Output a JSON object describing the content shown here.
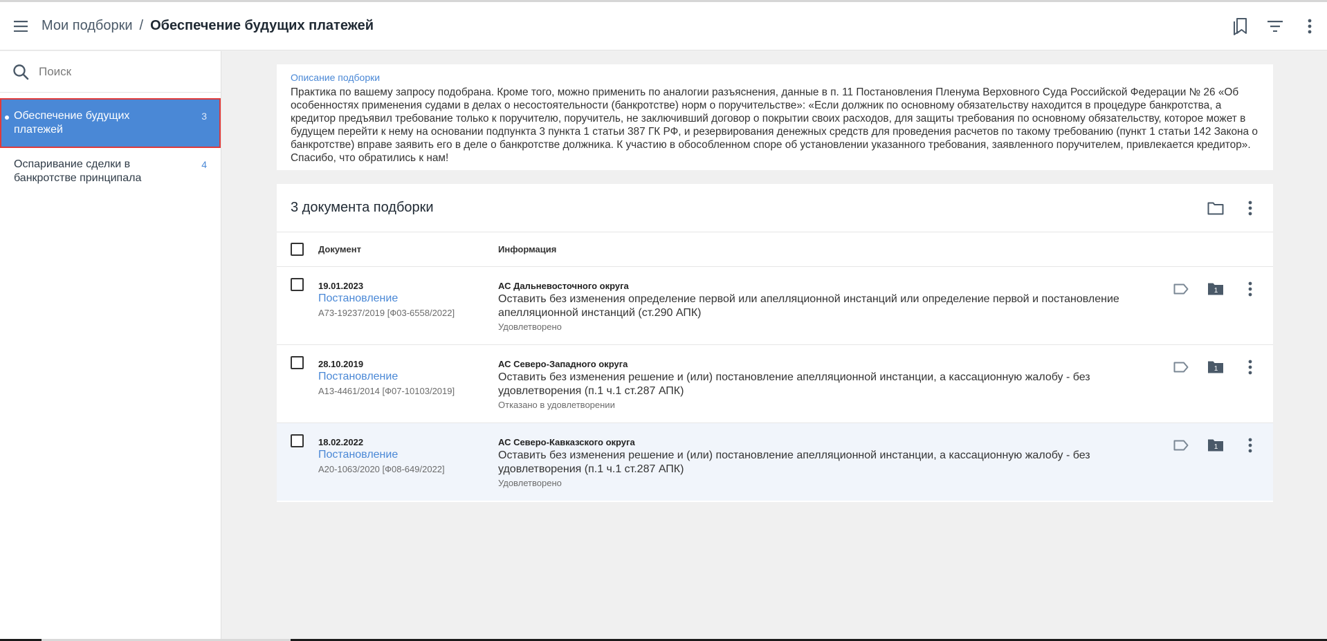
{
  "header": {
    "breadcrumb_root": "Мои подборки",
    "breadcrumb_sep": "/",
    "breadcrumb_current": "Обеспечение будущих платежей"
  },
  "sidebar": {
    "search_placeholder": "Поиск",
    "items": [
      {
        "label": "Обеспечение будущих платежей",
        "count": "3",
        "active": true
      },
      {
        "label": "Оспаривание сделки в банкротстве принципала",
        "count": "4",
        "active": false
      }
    ]
  },
  "description": {
    "title": "Описание подборки",
    "text": "Практика по вашему запросу подобрана. Кроме того, можно применить по аналогии разъяснения, данные в п. 11 Постановления Пленума Верховного Суда Российской Федерации № 26 «Об особенностях применения судами в делах о несостоятельности (банкротстве) норм о поручительстве»: «Если должник по основному обязательству находится в процедуре банкротства, а кредитор предъявил требование только к поручителю, поручитель, не заключивший договор о покрытии своих расходов, для защиты требования по основному обязательству, которое может в будущем перейти к нему на основании подпункта 3 пункта 1 статьи 387 ГК РФ, и резервирования денежных средств для проведения расчетов по такому требованию (пункт 1 статьи 142 Закона о банкротстве) вправе заявить его в деле о банкротстве должника. К участию в обособленном споре об установлении указанного требования, заявленного поручителем, привлекается кредитор». Спасибо, что обратились к нам!"
  },
  "documents": {
    "title": "3 документа подборки",
    "col_document": "Документ",
    "col_info": "Информация",
    "rows": [
      {
        "date": "19.01.2023",
        "type": "Постановление",
        "number": "А73-19237/2019 [Ф03-6558/2022]",
        "court": "АС Дальневосточного округа",
        "text": "Оставить без изменения определение первой или апелляционной инстанций или определение первой и постановление апелляционной инстанций (ст.290 АПК)",
        "status": "Удовлетворено",
        "folder_count": "1"
      },
      {
        "date": "28.10.2019",
        "type": "Постановление",
        "number": "А13-4461/2014 [Ф07-10103/2019]",
        "court": "АС Северо-Западного округа",
        "text": "Оставить без изменения решение и (или) постановление апелляционной инстанции, а кассационную жалобу - без удовлетворения (п.1 ч.1 ст.287 АПК)",
        "status": "Отказано в удовлетворении",
        "folder_count": "1"
      },
      {
        "date": "18.02.2022",
        "type": "Постановление",
        "number": "А20-1063/2020 [Ф08-649/2022]",
        "court": "АС Северо-Кавказского округа",
        "text": "Оставить без изменения решение и (или) постановление апелляционной инстанции, а кассационную жалобу - без удовлетворения (п.1 ч.1 ст.287 АПК)",
        "status": "Удовлетворено",
        "folder_count": "1"
      }
    ]
  },
  "icons": {
    "menu": "menu-icon",
    "bookmarks": "bookmarks-icon",
    "filter": "filter-icon",
    "more": "more-vert-icon",
    "search": "search-icon",
    "folder": "folder-icon",
    "tag": "tag-icon"
  },
  "colors": {
    "accent": "#4a88d6",
    "active_outline": "#e03a3a",
    "background": "#f0f0f0"
  }
}
